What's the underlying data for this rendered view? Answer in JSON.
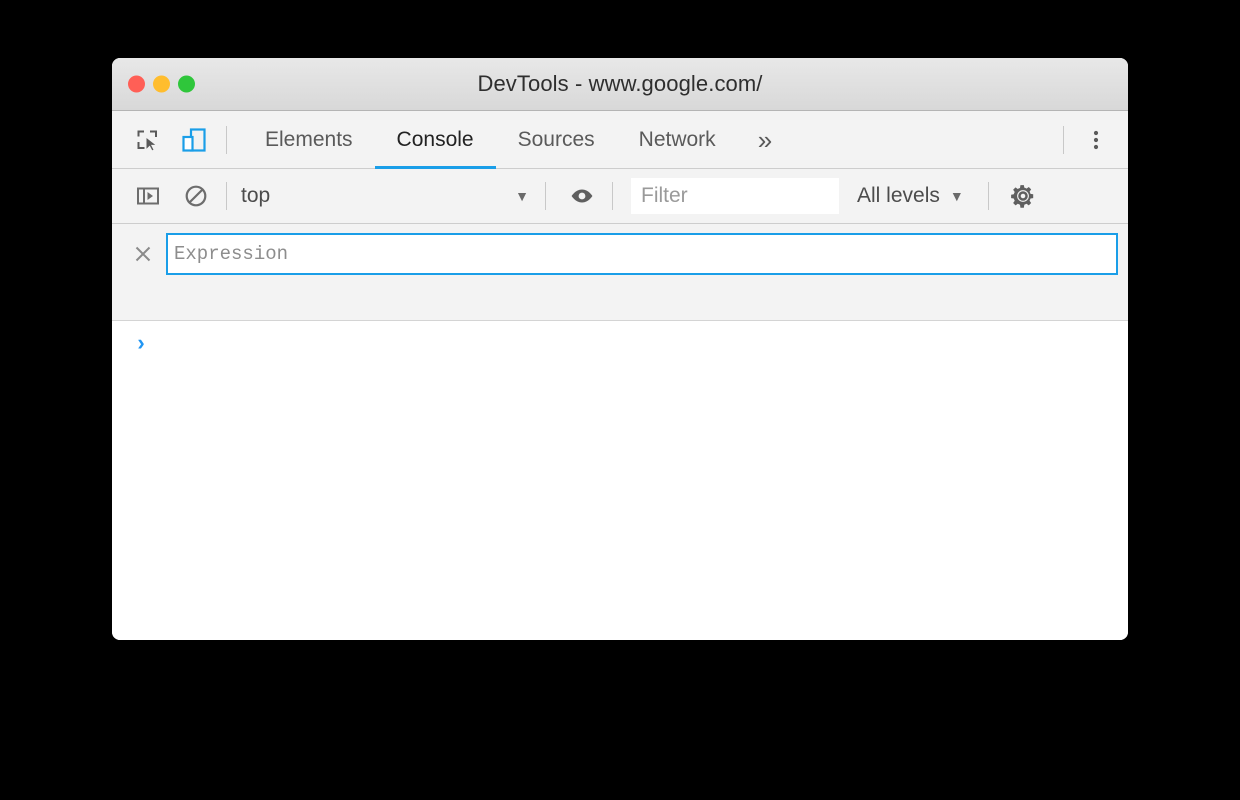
{
  "window": {
    "title": "DevTools - www.google.com/",
    "traffic_lights": [
      {
        "name": "close",
        "color": "#ff5f56"
      },
      {
        "name": "minimize",
        "color": "#ffbd2e"
      },
      {
        "name": "zoom",
        "color": "#2fc63b"
      }
    ]
  },
  "tabbar": {
    "inspect_icon": "inspect-cursor-icon",
    "device_toggle_icon": "device-toolbar-icon",
    "device_toggle_active": true,
    "accent_color": "#1a9ee8",
    "tabs": [
      {
        "label": "Elements",
        "active": false
      },
      {
        "label": "Console",
        "active": true
      },
      {
        "label": "Sources",
        "active": false
      },
      {
        "label": "Network",
        "active": false
      }
    ],
    "overflow_label": "»",
    "menu_icon": "more-vertical-icon"
  },
  "console_toolbar": {
    "sidebar_icon": "show-console-sidebar-icon",
    "clear_icon": "clear-console-icon",
    "context": {
      "value": "top",
      "caret": "▼"
    },
    "eye_icon": "live-expression-eye-icon",
    "filter": {
      "value": "",
      "placeholder": "Filter"
    },
    "levels": {
      "value": "All levels",
      "caret": "▼"
    },
    "settings_icon": "settings-gear-icon"
  },
  "eval_pane": {
    "close_icon": "close-x-icon",
    "expression": {
      "value": "",
      "placeholder": "Expression"
    },
    "border_color": "#1a9ee8"
  },
  "console_output": {
    "prompt_chevron": "›",
    "prompt_color": "#2196f3",
    "messages": []
  }
}
